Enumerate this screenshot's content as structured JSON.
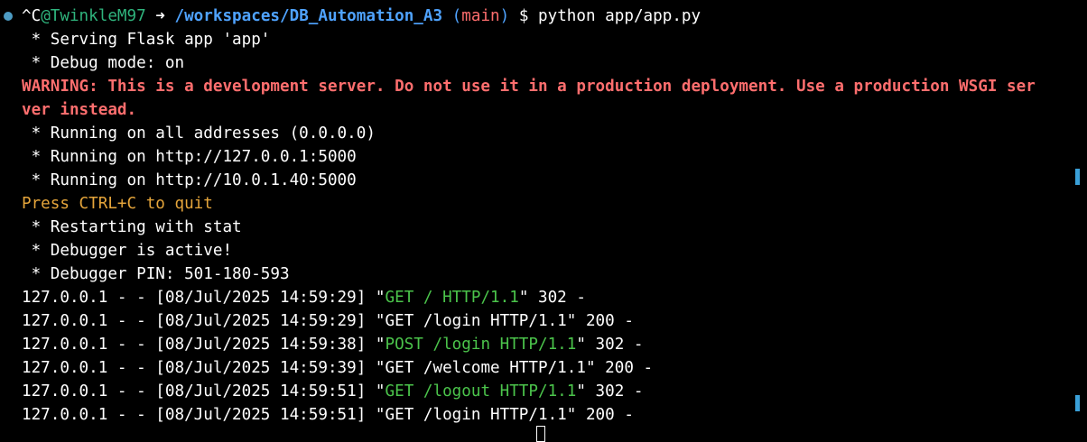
{
  "prompt": {
    "ctrl_c": "^C",
    "user": "@TwinkleM97",
    "arrow": " ➜ ",
    "path": "/workspaces/DB_Automation_A3",
    "branch_open": " (",
    "branch": "main",
    "branch_close": ")",
    "dollar_cmd": " $ python app/app.py"
  },
  "lines": [
    " * Serving Flask app 'app'",
    " * Debug mode: on"
  ],
  "warning_line_1": "WARNING: This is a development server. Do not use it in a production deployment. Use a production WSGI ser",
  "warning_line_2": "ver instead.",
  "running": [
    " * Running on all addresses (0.0.0.0)",
    " * Running on http://127.0.0.1:5000",
    " * Running on http://10.0.1.40:5000"
  ],
  "quit": "Press CTRL+C to quit",
  "restart": [
    " * Restarting with stat",
    " * Debugger is active!",
    " * Debugger PIN: 501-180-593"
  ],
  "log": [
    {
      "prefix": "127.0.0.1 - - [08/Jul/2025 14:59:29] \"",
      "request": "GET / HTTP/1.1",
      "suffix": "\" 302 -",
      "green": true
    },
    {
      "prefix": "127.0.0.1 - - [08/Jul/2025 14:59:29] \"",
      "request": "GET /login HTTP/1.1",
      "suffix": "\" 200 -",
      "green": false
    },
    {
      "prefix": "127.0.0.1 - - [08/Jul/2025 14:59:38] \"",
      "request": "POST /login HTTP/1.1",
      "suffix": "\" 302 -",
      "green": true
    },
    {
      "prefix": "127.0.0.1 - - [08/Jul/2025 14:59:39] \"",
      "request": "GET /welcome HTTP/1.1",
      "suffix": "\" 200 -",
      "green": false
    },
    {
      "prefix": "127.0.0.1 - - [08/Jul/2025 14:59:51] \"",
      "request": "GET /logout HTTP/1.1",
      "suffix": "\" 302 -",
      "green": true
    },
    {
      "prefix": "127.0.0.1 - - [08/Jul/2025 14:59:51] \"",
      "request": "GET /login HTTP/1.1",
      "suffix": "\" 200 -",
      "green": false
    }
  ],
  "colors": {
    "background": "#000000",
    "foreground": "#ffffff",
    "user": "#2fb47d",
    "path": "#4fa3ff",
    "branch": "#ff6e6e",
    "warning": "#ff6e6e",
    "quit": "#e5a53b",
    "request_green": "#4bc44b"
  }
}
